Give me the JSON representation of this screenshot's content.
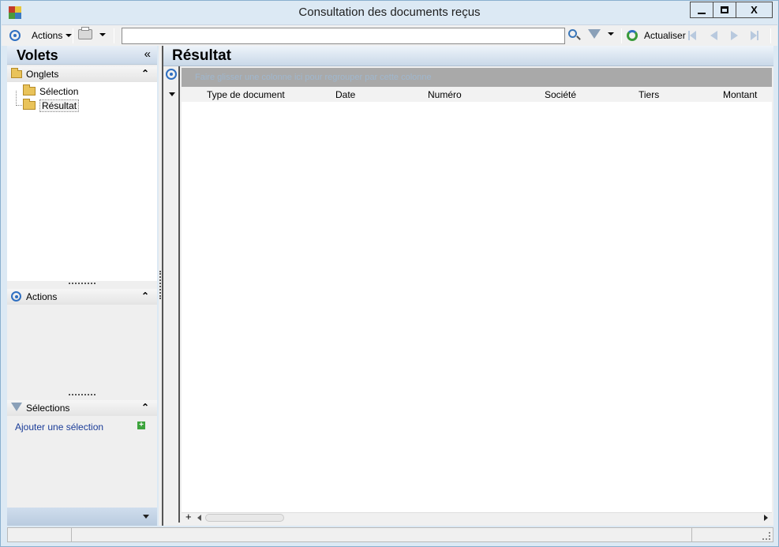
{
  "window": {
    "title": "Consultation des documents reçus"
  },
  "titlebar_buttons": {
    "minimize": "▁",
    "maximize": "▢",
    "close": "X"
  },
  "toolbar": {
    "actions_label": "Actions",
    "search_value": "",
    "refresh_label": "Actualiser"
  },
  "left_panel": {
    "title": "Volets",
    "collapse_glyph": "«",
    "onglets": {
      "label": "Onglets",
      "items": [
        "Sélection",
        "Résultat"
      ],
      "selected": "Résultat"
    },
    "actions": {
      "label": "Actions"
    },
    "selections": {
      "label": "Sélections",
      "add_label": "Ajouter une sélection"
    }
  },
  "result_panel": {
    "title": "Résultat",
    "group_hint": "Faire glisser une colonne ici pour regrouper par cette colonne",
    "columns": [
      "Type de document",
      "Date",
      "Numéro",
      "Société",
      "Tiers",
      "Montant"
    ]
  },
  "colors": {
    "accent": "#2f6fc1",
    "header_gradient_bottom": "#c9d8e8",
    "group_bar": "#a9a9a9"
  }
}
